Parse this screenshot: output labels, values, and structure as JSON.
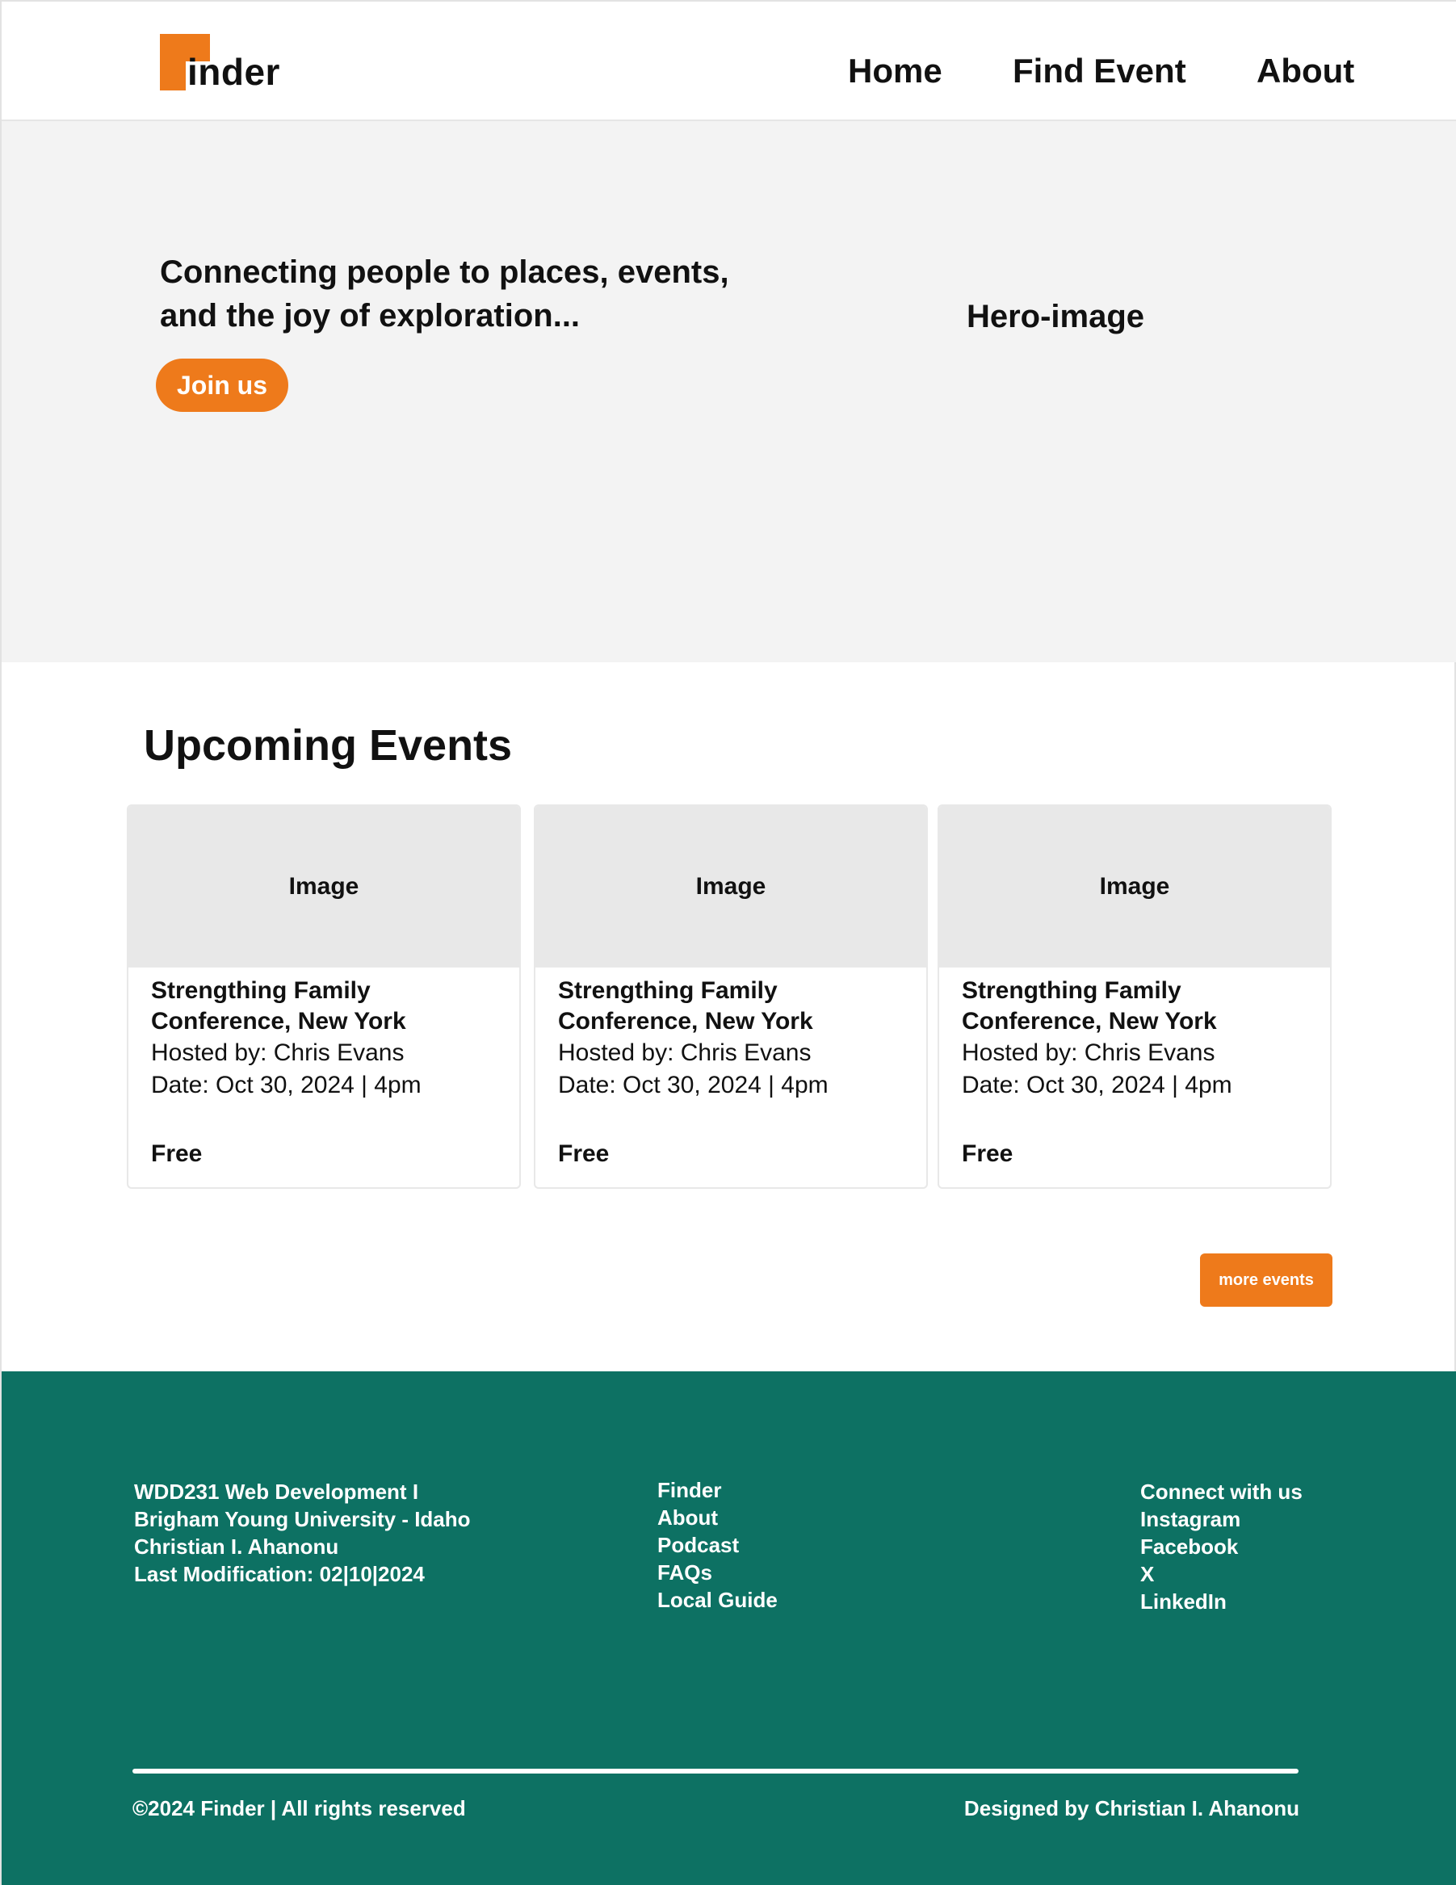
{
  "header": {
    "logo_text": "inder",
    "nav": [
      {
        "label": "Home"
      },
      {
        "label": "Find Event"
      },
      {
        "label": "About"
      }
    ]
  },
  "hero": {
    "headline": "Connecting people to places, events, and the joy of exploration...",
    "cta_label": "Join us",
    "image_placeholder": "Hero-image"
  },
  "events": {
    "title": "Upcoming Events",
    "cards": [
      {
        "image": "Image",
        "title": "Strengthing Family Conference, New York",
        "host": "Hosted by: Chris Evans",
        "date": "Date: Oct 30, 2024 | 4pm",
        "price": "Free"
      },
      {
        "image": "Image",
        "title": "Strengthing Family Conference, New York",
        "host": "Hosted by: Chris Evans",
        "date": "Date: Oct 30, 2024 | 4pm",
        "price": "Free"
      },
      {
        "image": "Image",
        "title": "Strengthing Family Conference, New York",
        "host": "Hosted by: Chris Evans",
        "date": "Date: Oct 30, 2024 | 4pm",
        "price": "Free"
      }
    ],
    "more_label": "more events"
  },
  "footer": {
    "info": [
      "WDD231 Web Development I",
      "Brigham Young University - Idaho",
      "Christian I. Ahanonu",
      "Last Modification: 02|10|2024"
    ],
    "links": [
      "Finder",
      "About",
      "Podcast",
      "FAQs",
      "Local Guide"
    ],
    "social": [
      "Connect with us",
      "Instagram",
      "Facebook",
      "X",
      "LinkedIn"
    ],
    "copyright": "©2024 Finder | All rights reserved",
    "credit": "Designed by Christian I. Ahanonu"
  },
  "colors": {
    "accent": "#EE7A1B",
    "footer_bg": "#0D7163",
    "hero_bg": "#F3F3F3",
    "card_image_bg": "#E8E8E8"
  }
}
